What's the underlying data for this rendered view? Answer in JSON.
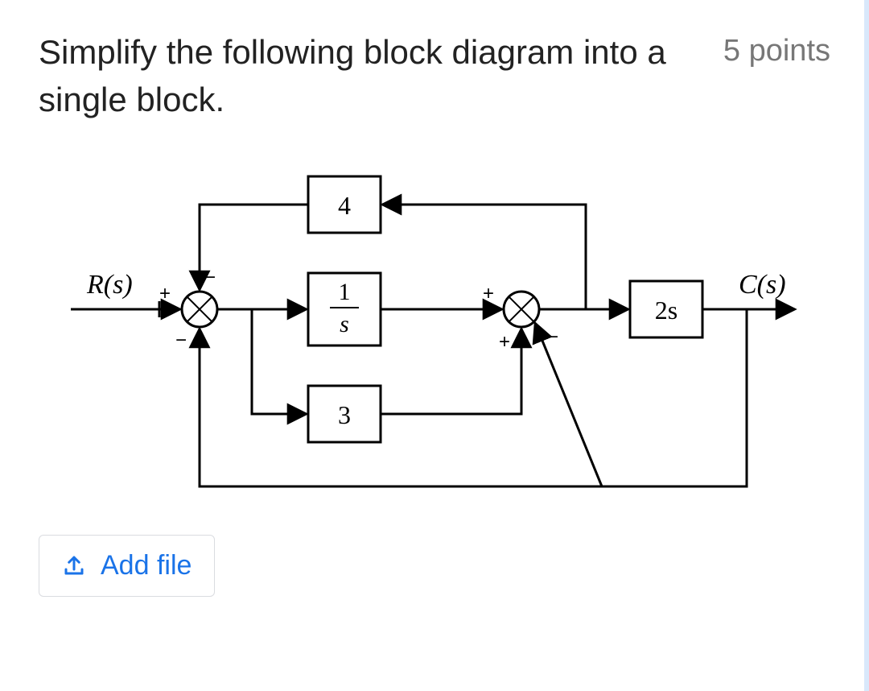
{
  "question": {
    "title": "Simplify the following block diagram into a single block.",
    "points_label": "5 points"
  },
  "diagram": {
    "input_label": "R(s)",
    "output_label": "C(s)",
    "blocks": {
      "feedback_top": "4",
      "forward_mid_numerator": "1",
      "forward_mid_denominator": "s",
      "parallel_bottom": "3",
      "forward_right": "2s"
    },
    "sum1_signs": {
      "left": "+",
      "top": "−",
      "bottom": "−"
    },
    "sum2_signs": {
      "left": "+",
      "bottom": "+",
      "diag": "−"
    }
  },
  "actions": {
    "add_file_label": "Add file"
  }
}
